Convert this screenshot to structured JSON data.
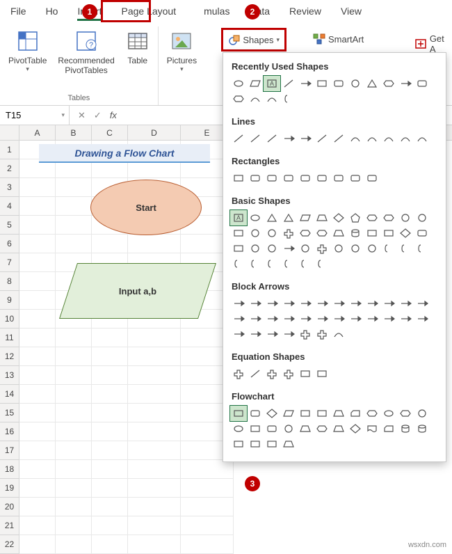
{
  "tabs": {
    "file": "File",
    "home": "Ho",
    "insert": "Insert",
    "pagelayout": "Page Layout",
    "formulas": "mulas",
    "data": "Data",
    "review": "Review",
    "view": "View"
  },
  "ribbon": {
    "pivottable": "PivotTable",
    "recpivot": "Recommended\nPivotTables",
    "table": "Table",
    "pictures": "Pictures",
    "shapes": "Shapes",
    "smartart": "SmartArt",
    "geta": "Get A",
    "tables_group": "Tables"
  },
  "callouts": {
    "one": "1",
    "two": "2",
    "three": "3"
  },
  "namebox": "T15",
  "cols": [
    "A",
    "B",
    "C",
    "D",
    "E"
  ],
  "rows": [
    "1",
    "2",
    "3",
    "4",
    "5",
    "6",
    "7",
    "8",
    "9",
    "10",
    "11",
    "12",
    "13",
    "14",
    "15",
    "16",
    "17",
    "18",
    "19",
    "20",
    "21",
    "22"
  ],
  "worksheet": {
    "banner": "Drawing a Flow Chart",
    "oval": "Start",
    "para": "Input a,b"
  },
  "dropdown": {
    "recent": "Recently Used Shapes",
    "lines": "Lines",
    "rects": "Rectangles",
    "basic": "Basic Shapes",
    "block": "Block Arrows",
    "eq": "Equation Shapes",
    "flow": "Flowchart"
  },
  "watermark": "wsxdn.com"
}
